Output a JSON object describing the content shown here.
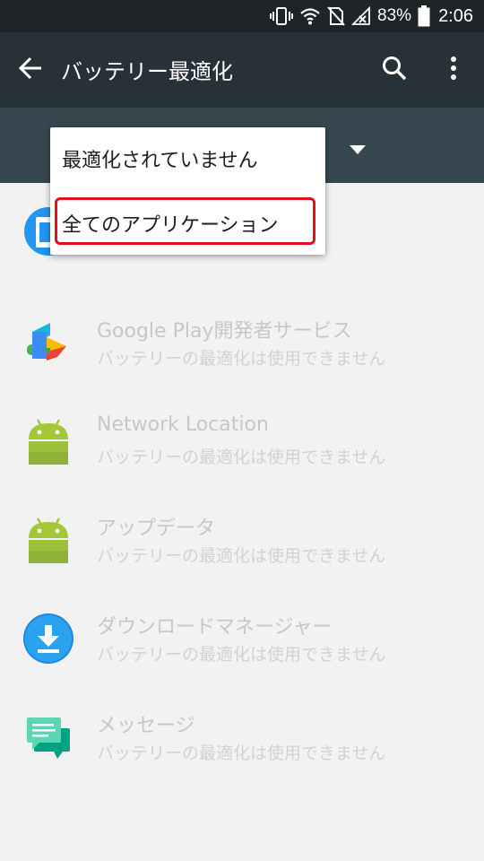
{
  "status_bar": {
    "battery": "83%",
    "time": "2:06"
  },
  "toolbar": {
    "title": "バッテリー最適化"
  },
  "menu": {
    "items": [
      {
        "label": "最適化されていません"
      },
      {
        "label": "全てのアプリケーション"
      }
    ]
  },
  "apps": [
    {
      "name": "Google Play開発者サービス",
      "status": "バッテリーの最適化は使用できません",
      "icon": "google-play-services-icon"
    },
    {
      "name": "Network Location",
      "status": "バッテリーの最適化は使用できません",
      "icon": "android-icon"
    },
    {
      "name": "アップデータ",
      "status": "バッテリーの最適化は使用できません",
      "icon": "android-icon"
    },
    {
      "name": "ダウンロードマネージャー",
      "status": "バッテリーの最適化は使用できません",
      "icon": "download-icon"
    },
    {
      "name": "メッセージ",
      "status": "バッテリーの最適化は使用できません",
      "icon": "messages-icon"
    }
  ],
  "colors": {
    "status_bar": "#1f2427",
    "toolbar": "#263238",
    "filter_band": "#37474f",
    "highlight": "#e0101e"
  }
}
